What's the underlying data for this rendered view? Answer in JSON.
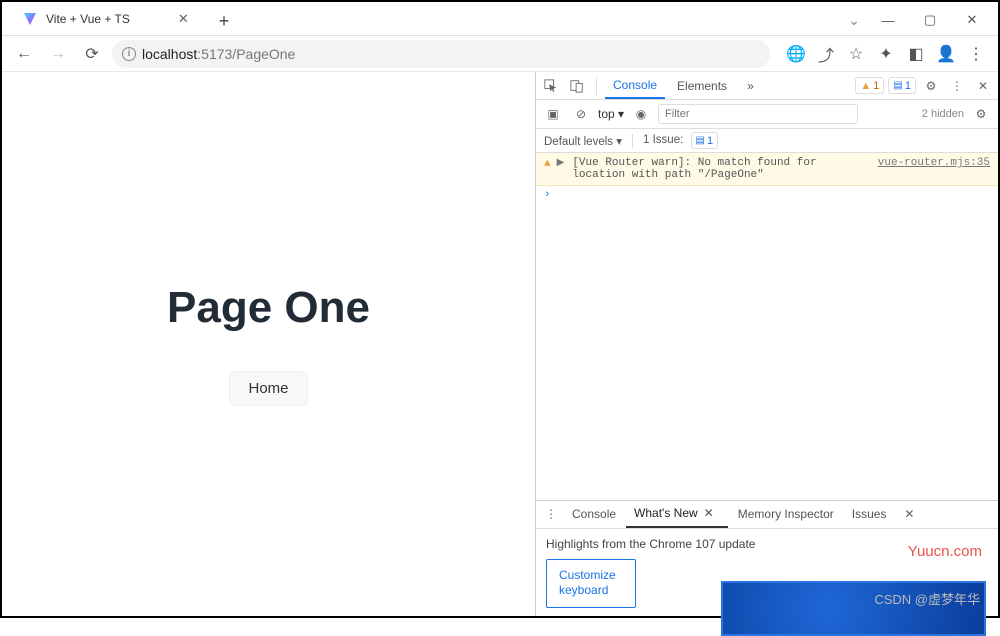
{
  "window": {
    "tab_title": "Vite + Vue + TS"
  },
  "toolbar": {
    "url_host": "localhost",
    "url_port_path": ":5173/PageOne"
  },
  "page": {
    "heading": "Page One",
    "button": "Home"
  },
  "devtools": {
    "tabs": {
      "console": "Console",
      "elements": "Elements"
    },
    "warn_count": "1",
    "msg_count": "1",
    "context": "top",
    "filter_placeholder": "Filter",
    "hidden": "2 hidden",
    "levels_label": "Default levels",
    "issues_label": "1 Issue:",
    "issues_count": "1",
    "log": {
      "text": "[Vue Router warn]: No match found for location with path \"/PageOne\"",
      "source": "vue-router.mjs:35"
    },
    "drawer": {
      "console": "Console",
      "whatsnew": "What's New",
      "memory": "Memory Inspector",
      "issues": "Issues",
      "headline": "Highlights from the Chrome 107 update",
      "card": "Customize keyboard"
    }
  },
  "watermarks": {
    "site": "Yuucn.com",
    "author": "CSDN @虚梦年华"
  }
}
